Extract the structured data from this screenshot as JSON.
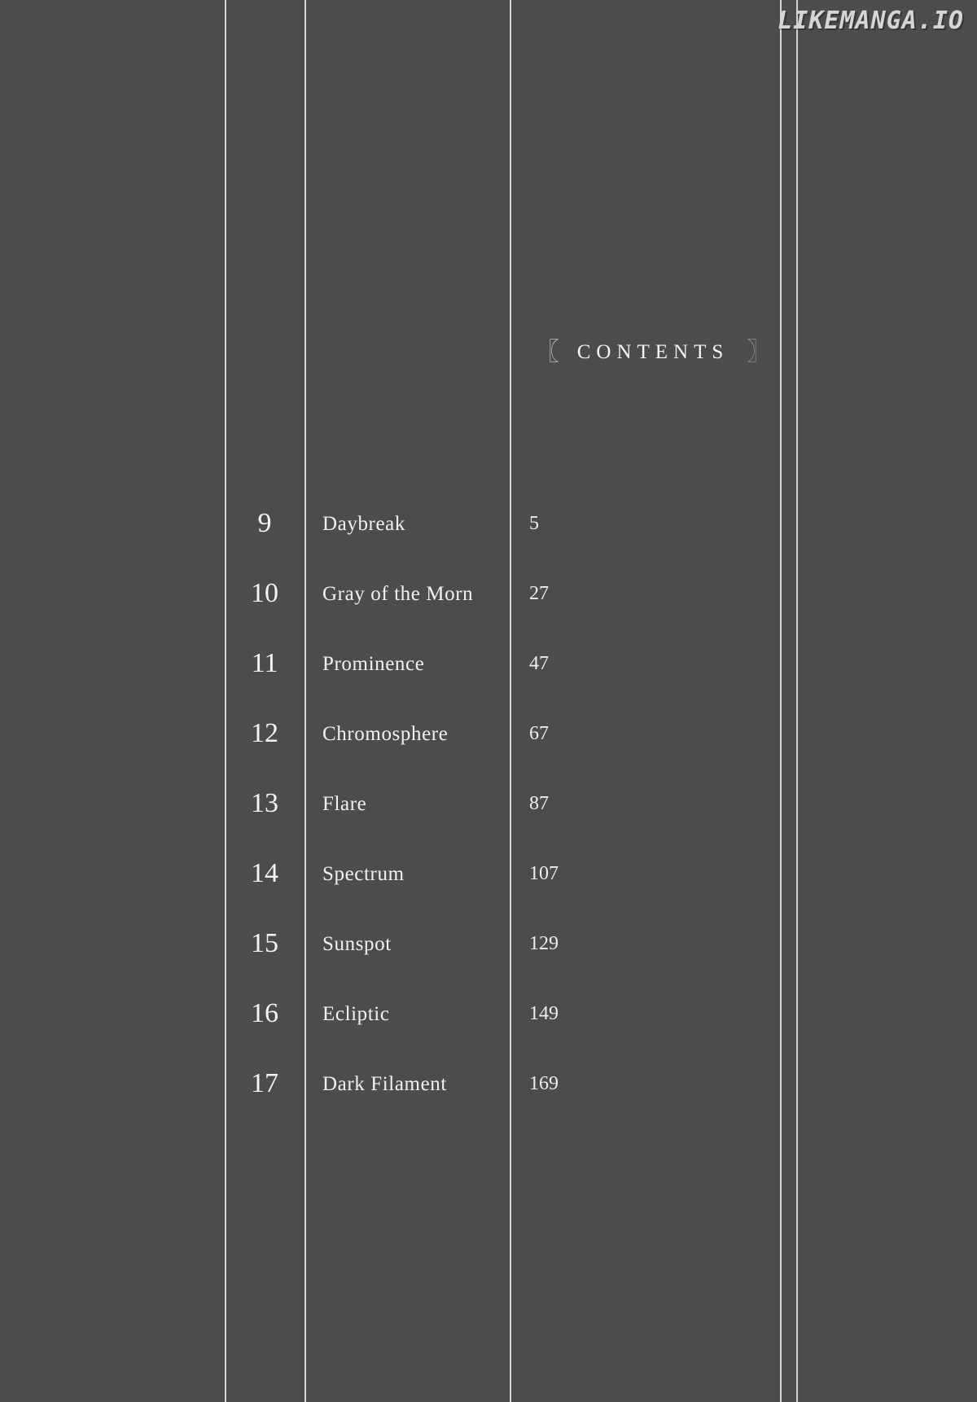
{
  "watermark": {
    "text": "LIKEMANGA.IO"
  },
  "heading": {
    "left_bracket": "〖",
    "title": "CONTENTS",
    "right_bracket": "〗"
  },
  "colors": {
    "background": "#4c4c4c",
    "rule": "#d8d8d6",
    "text": "#f2f2f0",
    "watermark": "#d5d5d3"
  },
  "contents": {
    "columns": [
      "chapter",
      "title",
      "page"
    ],
    "rows": [
      {
        "chapter": "9",
        "title": "Daybreak",
        "page": "5"
      },
      {
        "chapter": "10",
        "title": "Gray of the Morn",
        "page": "27"
      },
      {
        "chapter": "11",
        "title": "Prominence",
        "page": "47"
      },
      {
        "chapter": "12",
        "title": "Chromosphere",
        "page": "67"
      },
      {
        "chapter": "13",
        "title": "Flare",
        "page": "87"
      },
      {
        "chapter": "14",
        "title": "Spectrum",
        "page": "107"
      },
      {
        "chapter": "15",
        "title": "Sunspot",
        "page": "129"
      },
      {
        "chapter": "16",
        "title": "Ecliptic",
        "page": "149"
      },
      {
        "chapter": "17",
        "title": "Dark Filament",
        "page": "169"
      }
    ]
  }
}
